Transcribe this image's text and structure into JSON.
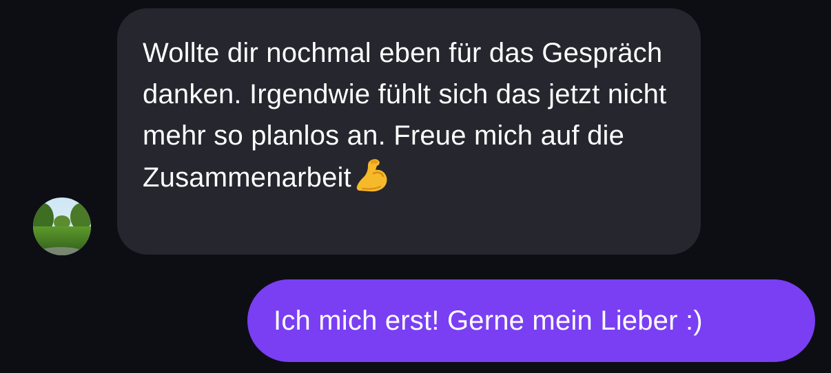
{
  "conversation": {
    "incoming": {
      "sender_avatar": "avatar-photo-icon",
      "text": "Wollte dir nochmal eben für das Gespräch danken. Irgendwie fühlt sich das jetzt nicht mehr so planlos an. Freue mich auf die Zusammenarbeit",
      "emoji": "flexed-biceps-icon"
    },
    "outgoing": {
      "text": "Ich mich erst! Gerne mein Lieber :)"
    }
  },
  "colors": {
    "background": "#0d0e14",
    "incoming_bubble": "#25262e",
    "outgoing_bubble": "#7a3ff3",
    "text": "#ffffff"
  }
}
